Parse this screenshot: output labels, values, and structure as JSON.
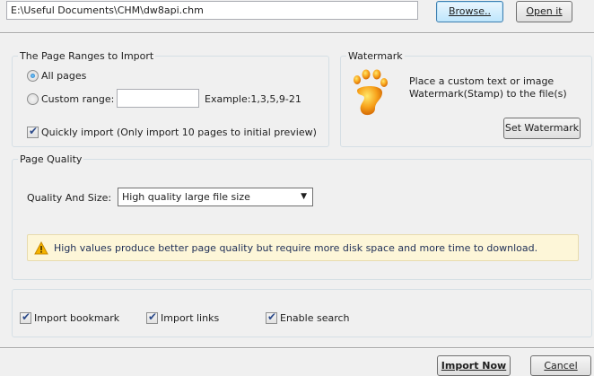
{
  "file": {
    "path": "E:\\Useful Documents\\CHM\\dw8api.chm",
    "browse_label": "Browse..",
    "open_label": "Open it"
  },
  "page_ranges": {
    "legend": "The Page Ranges to Import",
    "all_pages": "All pages",
    "custom_range": "Custom range:",
    "custom_value": "",
    "example": "Example:1,3,5,9-21",
    "quick_import": "Quickly import (Only import 10 pages to  initial  preview)"
  },
  "watermark": {
    "legend": "Watermark",
    "description_line1": "Place a custom text or image",
    "description_line2": "Watermark(Stamp) to the file(s)",
    "button_label": "Set Watermark"
  },
  "quality": {
    "legend": "Page Quality",
    "label": "Quality And Size:",
    "selected": "High quality large file size",
    "warning": "High values produce better page quality but require more disk space and more time to download."
  },
  "options": {
    "bookmark": "Import bookmark",
    "links": "Import links",
    "search": "Enable search"
  },
  "footer": {
    "import_label": "Import Now",
    "cancel_label": "Cancel"
  },
  "colors": {
    "background": "#f0f0f0",
    "warning_bg": "#fdf6d8",
    "accent": "#176ebd"
  }
}
